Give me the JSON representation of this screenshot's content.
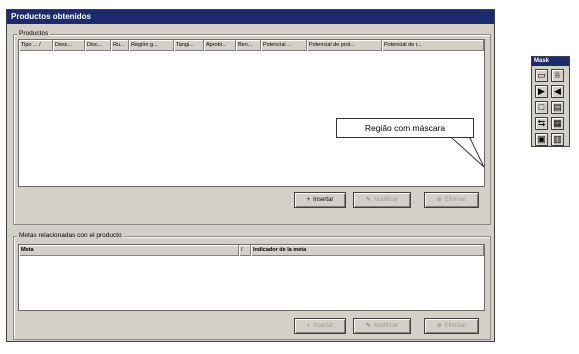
{
  "window": {
    "title": "Productos obtenidos"
  },
  "products": {
    "group_label": "Productos",
    "columns": [
      "Tipo ... /",
      "Desc...",
      "Disc...",
      "Ru...",
      "Región g...",
      "Tangi...",
      "Aprobi...",
      "Ben...",
      "Potencial ...",
      "Potencial de prot...",
      "Potencial de i..."
    ],
    "buttons": {
      "insert": "Insertar",
      "modify": "Modificar",
      "delete": "Eliminar"
    }
  },
  "goals": {
    "group_label": "Metas relacionadas con el producto",
    "columns": [
      "Meta",
      "/",
      "Indicador de la meta"
    ],
    "buttons": {
      "insert": "Insertar",
      "modify": "Modificar",
      "delete": "Eliminar"
    }
  },
  "callout": {
    "text": "Região com máscara"
  },
  "mask_panel": {
    "title": "Mask",
    "buttons": [
      "window-icon",
      "trophy-icon",
      "play-icon",
      "back-icon",
      "blank-icon",
      "document-icon",
      "swap-icon",
      "grid-search-icon",
      "save-icon",
      "trash-icon"
    ]
  }
}
